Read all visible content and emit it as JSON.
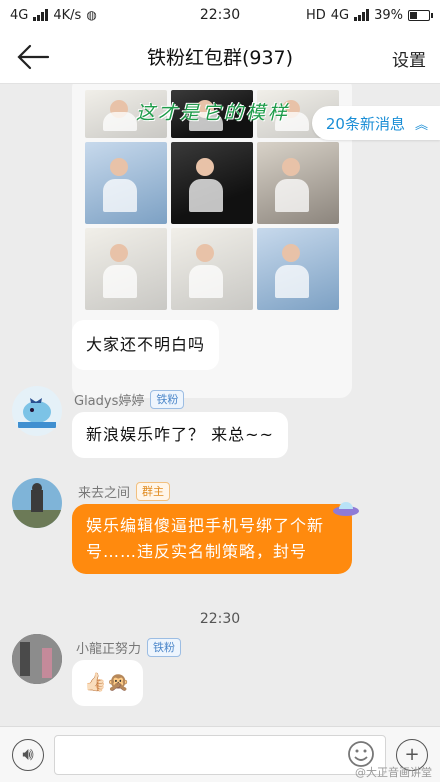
{
  "status": {
    "network": "4G",
    "speed": "4K/s",
    "time": "22:30",
    "hd": "HD",
    "network2": "4G",
    "battery": "39%",
    "battery_level": 0.39
  },
  "nav": {
    "title": "铁粉红包群(937)",
    "settings": "设置"
  },
  "overlay_text": "这才是它的模样",
  "new_messages": "20条新消息",
  "messages": [
    {
      "text": "大家还不明白吗"
    },
    {
      "sender": "Gladys婷婷",
      "tag": "铁粉",
      "text": "新浪娱乐咋了？ 来总~~"
    },
    {
      "sender": "来去之间",
      "tag": "群主",
      "text": "娱乐编辑傻逼把手机号绑了个新号……违反实名制策略，封号"
    },
    {
      "sender": "小龍正努力",
      "tag": "铁粉",
      "text": "👍🏻🙊"
    }
  ],
  "time_separator": "22:30",
  "input": {
    "placeholder": ""
  },
  "watermark": "@大正音画讲堂"
}
